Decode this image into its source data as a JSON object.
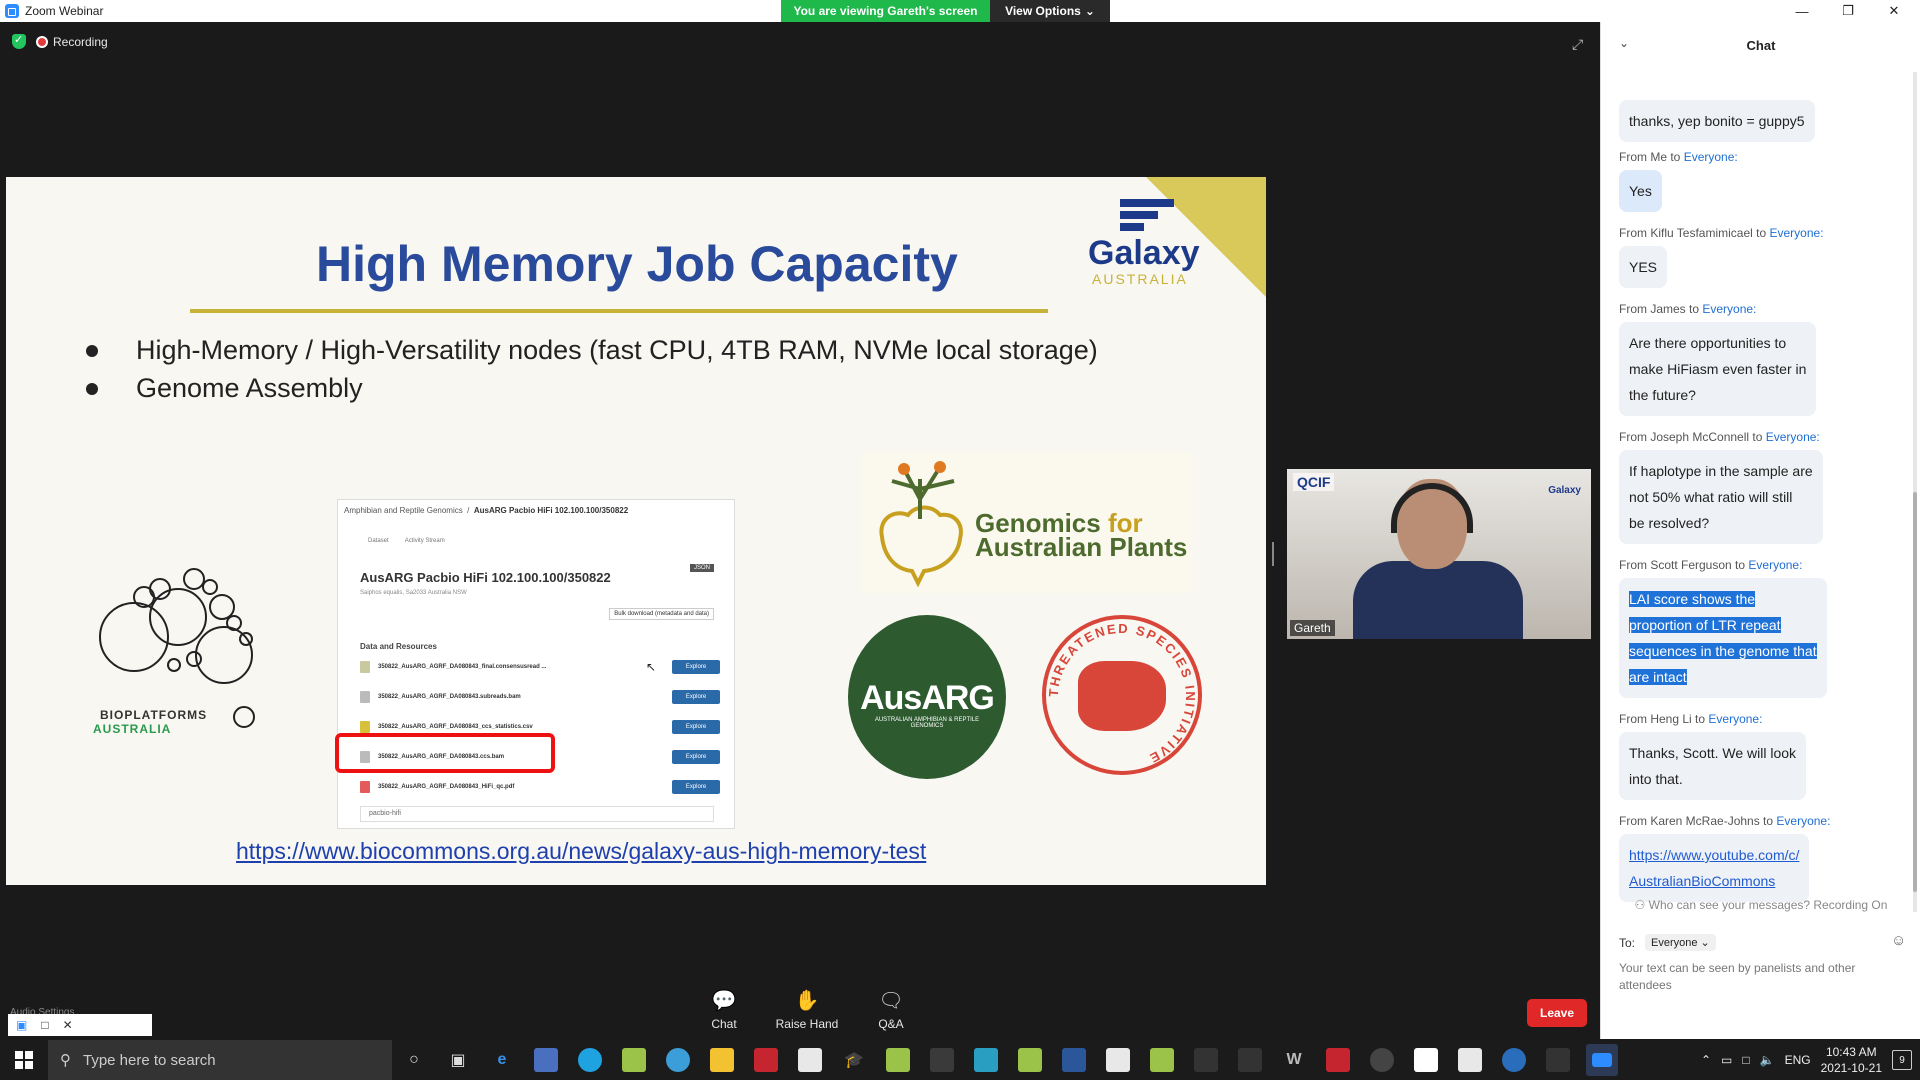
{
  "window": {
    "title": "Zoom Webinar",
    "minimize_icon": "minimize-icon",
    "restore_icon": "restore-icon",
    "close_icon": "close-icon"
  },
  "share_banner": {
    "text": "You are viewing Gareth's screen",
    "color": "#1fb84a"
  },
  "view_options": {
    "label": "View Options"
  },
  "meeting": {
    "recording_label": "Recording",
    "security_icon": "shield-check-icon",
    "fullscreen_icon": "fullscreen-icon"
  },
  "slide": {
    "title": "High Memory Job Capacity",
    "bullets": [
      "High-Memory / High-Versatility nodes (fast CPU, 4TB RAM, NVMe local storage)",
      "Genome Assembly"
    ],
    "galaxy_logo": {
      "name": "Galaxy",
      "sub": "AUSTRALIA"
    },
    "bioplatforms": {
      "line1": "BIOPLATFORMS",
      "line2": "AUSTRALIA"
    },
    "dataset_panel": {
      "breadcrumb_parent": "Amphibian and Reptile Genomics",
      "breadcrumb_current": "AusARG Pacbio HiFi 102.100.100/350822",
      "tabs": [
        "Dataset",
        "Activity Stream"
      ],
      "title": "AusARG Pacbio HiFi 102.100.100/350822",
      "subtitle": "Saiphos equalis, Sa2033 Australia NSW",
      "json_label": "JSON",
      "bulk_download": "Bulk download (metadata and data)",
      "section_heading": "Data and Resources",
      "files": [
        {
          "name": "350822_AusARG_AGRF_DA080843_final.consensusread ...",
          "action": "Explore"
        },
        {
          "name": "350822_AusARG_AGRF_DA080843.subreads.bam",
          "action": "Explore"
        },
        {
          "name": "350822_AusARG_AGRF_DA080843_ccs_statistics.csv",
          "action": "Explore"
        },
        {
          "name": "350822_AusARG_AGRF_DA080843.ccs.bam",
          "action": "Explore"
        },
        {
          "name": "350822_AusARG_AGRF_DA080843_HiFi_qc.pdf",
          "action": "Explore"
        }
      ],
      "tag": "pacbio-hifi"
    },
    "gap_logo": {
      "line1a": "Genomics",
      "line1b": "for",
      "line2": "Australian Plants"
    },
    "ausarg_logo": {
      "name": "AusARG",
      "sub": "AUSTRALIAN AMPHIBIAN & REPTILE GENOMICS"
    },
    "tsi_logo": {
      "text": "THREATENED SPECIES INITIATIVE"
    },
    "link": "https://www.biocommons.org.au/news/galaxy-aus-high-memory-test"
  },
  "speaker": {
    "name": "Gareth",
    "org_badge": "QCIF",
    "galaxy_badge": "Galaxy"
  },
  "controls": {
    "chat_label": "Chat",
    "raise_hand_label": "Raise Hand",
    "qa_label": "Q&A",
    "leave_label": "Leave",
    "audio_settings": "Audio Settings"
  },
  "chat": {
    "header": "Chat",
    "messages": [
      {
        "from": "",
        "to": "",
        "text": "thanks, yep bonito = guppy5"
      },
      {
        "from": "From Me to",
        "to": "Everyone:",
        "text": "Yes"
      },
      {
        "from": "From Kiflu Tesfamimicael to",
        "to": "Everyone:",
        "text": "YES"
      },
      {
        "from": "From James to",
        "to": "Everyone:",
        "text_lines": [
          "Are there opportunities to",
          "make HiFiasm even faster in",
          "the future?"
        ]
      },
      {
        "from": "From Joseph McConnell to",
        "to": "Everyone:",
        "text_lines": [
          "If haplotype in the sample are",
          "not 50% what ratio will still",
          "be resolved?"
        ]
      },
      {
        "from": "From Scott Ferguson to",
        "to": "Everyone:",
        "text_lines": [
          "LAI score shows the",
          "proportion of LTR repeat",
          "sequences in the genome that",
          "are intact"
        ]
      },
      {
        "from": "From Heng Li to",
        "to": "Everyone:",
        "text_lines": [
          "Thanks, Scott. We will look",
          "into that."
        ]
      },
      {
        "from": "From Karen McRae-Johns to",
        "to": "Everyone:",
        "link_lines": [
          "https://www.youtube.com/c/",
          "AustralianBioCommons"
        ]
      }
    ],
    "visibility_note": "Who can see your messages? Recording On",
    "to_label": "To:",
    "to_value": "Everyone",
    "input_placeholder": "Your text can be seen by panelists and other attendees"
  },
  "taskbar": {
    "search_placeholder": "Type here to search",
    "language": "ENG",
    "time": "10:43 AM",
    "date": "2021-10-21",
    "notifications": "9"
  }
}
